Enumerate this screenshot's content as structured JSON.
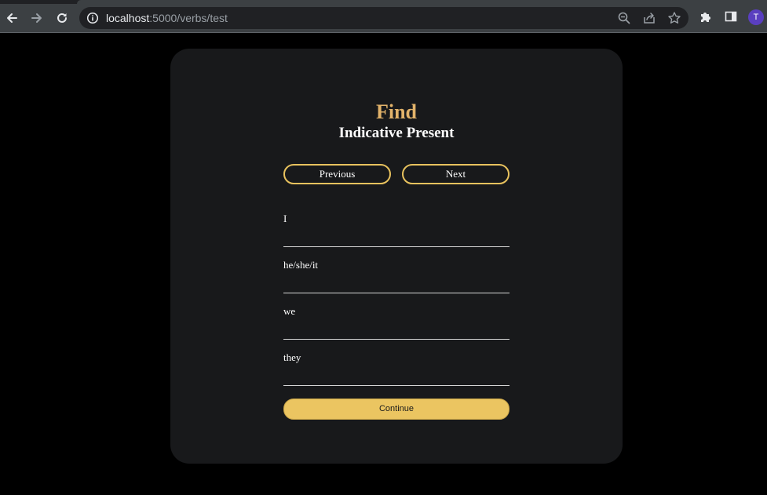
{
  "browser": {
    "url_host": "localhost",
    "url_path": ":5000/verbs/test",
    "profile_initial": "T",
    "icons": {
      "back": "arrow-left-icon",
      "forward": "arrow-right-icon",
      "reload": "reload-icon",
      "site_info": "info-icon",
      "zoom": "zoom-out-icon",
      "share": "share-icon",
      "bookmark": "star-icon",
      "extensions": "puzzle-icon",
      "side_panel": "side-panel-icon"
    }
  },
  "page": {
    "title": "Find",
    "subtitle": "Indicative Present",
    "previous_label": "Previous",
    "next_label": "Next",
    "fields": [
      {
        "label": "I",
        "value": ""
      },
      {
        "label": "he/she/it",
        "value": ""
      },
      {
        "label": "we",
        "value": ""
      },
      {
        "label": "they",
        "value": ""
      }
    ],
    "continue_label": "Continue"
  },
  "colors": {
    "background": "#000000",
    "card": "#18191b",
    "title_accent": "#e2b36a",
    "button_border": "#e8c25e",
    "continue_fill": "#ebc561",
    "avatar": "#5a3fc0"
  }
}
